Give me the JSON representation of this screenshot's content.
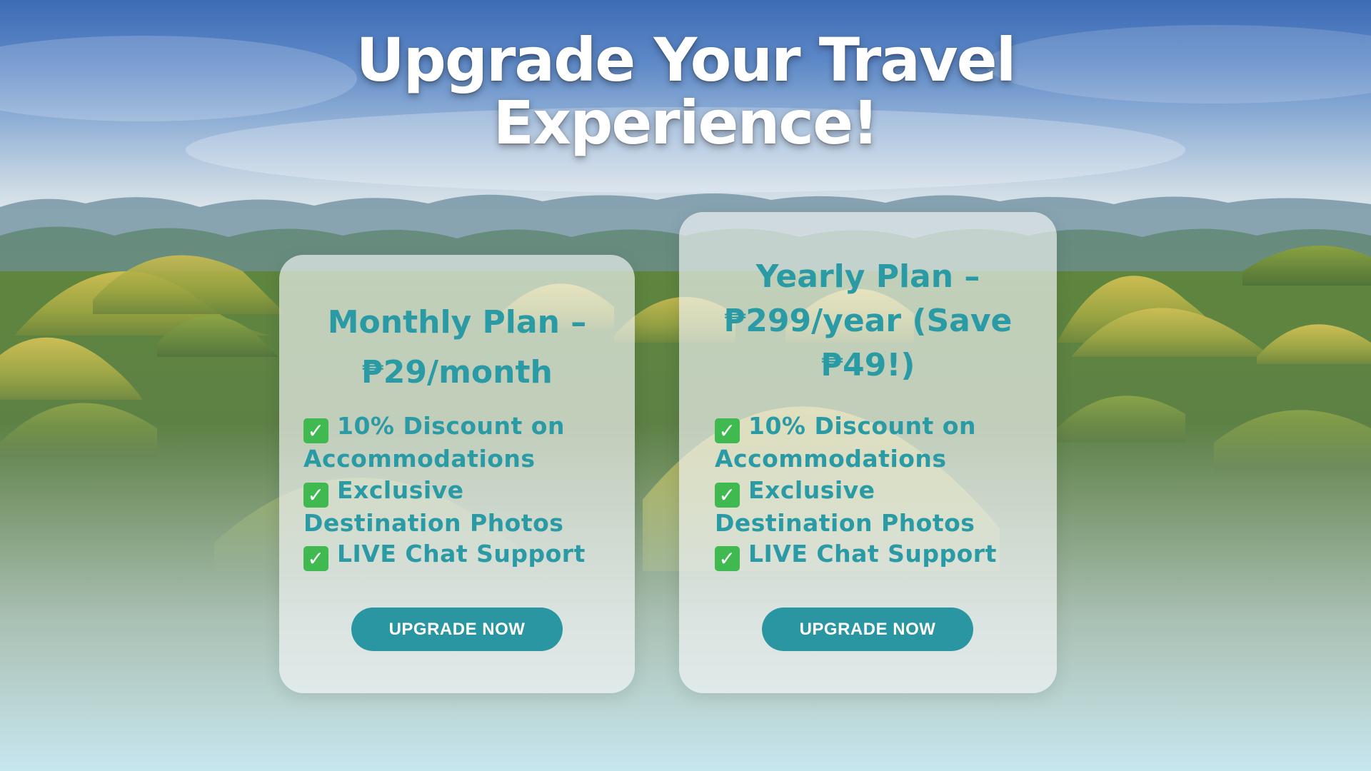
{
  "page": {
    "title_line1": "Upgrade Your Travel",
    "title_line2": "Experience!"
  },
  "plans": [
    {
      "title_line1": "Monthly Plan –",
      "title_line2": "₱29/month",
      "features": [
        {
          "line1": "10% Discount on",
          "line2": "Accommodations"
        },
        {
          "line1": "Exclusive",
          "line2": "Destination Photos"
        },
        {
          "line1": "LIVE Chat Support"
        }
      ],
      "button_label": "UPGRADE NOW"
    },
    {
      "title_line1": "Yearly Plan –",
      "title_line2": "₱299/year (Save",
      "title_line3": "₱49!)",
      "features": [
        {
          "line1": "10% Discount on",
          "line2": "Accommodations"
        },
        {
          "line1": "Exclusive",
          "line2": "Destination Photos"
        },
        {
          "line1": "LIVE Chat Support"
        }
      ],
      "button_label": "UPGRADE NOW"
    }
  ],
  "icons": {
    "check": "check-mark-icon",
    "check_glyph": "✓"
  },
  "colors": {
    "accent": "#2a9aa5",
    "button": "#2a96a2",
    "check": "#3fb950",
    "title": "#ffffff"
  }
}
